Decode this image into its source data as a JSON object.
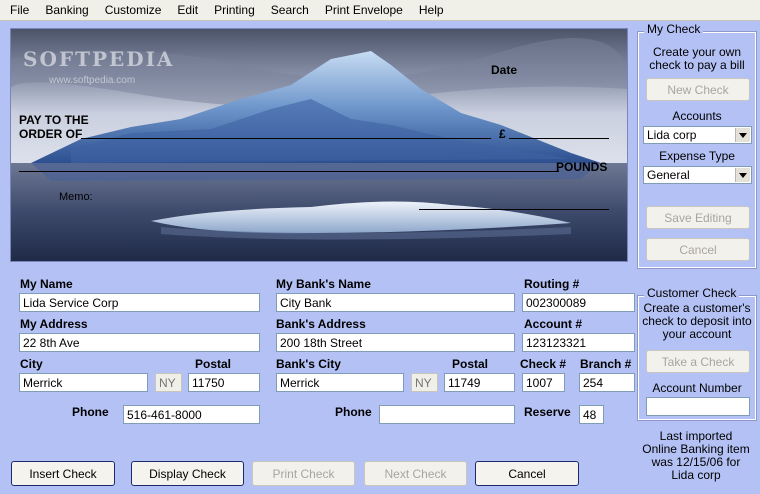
{
  "menu": [
    "File",
    "Banking",
    "Customize",
    "Edit",
    "Printing",
    "Search",
    "Print Envelope",
    "Help"
  ],
  "watermark": {
    "brand": "SOFTPEDIA",
    "url": "www.softpedia.com"
  },
  "check": {
    "date_label": "Date",
    "pay_to_line1": "PAY TO THE",
    "pay_to_line2": "ORDER OF",
    "currency_symbol": "£",
    "pounds_label": "POUNDS",
    "memo_label": "Memo:"
  },
  "my_check": {
    "title": "My Check",
    "description": "Create your own check to pay a bill",
    "new_check_label": "New Check",
    "accounts_label": "Accounts",
    "accounts_value": "Lida corp",
    "expense_label": "Expense Type",
    "expense_value": "General",
    "save_label": "Save Editing",
    "cancel_label": "Cancel"
  },
  "customer_check": {
    "title": "Customer Check",
    "description": "Create a customer's check to deposit into your account",
    "take_check_label": "Take a Check",
    "account_number_label": "Account Number",
    "account_number_value": ""
  },
  "import_note": "Last imported Online Banking item was 12/15/06 for Lida corp",
  "form": {
    "my_name_label": "My Name",
    "my_name": "Lida Service Corp",
    "my_address_label": "My Address",
    "my_address": "22 8th Ave",
    "city_label": "City",
    "city": "Merrick",
    "state_placeholder": "NY",
    "postal_label": "Postal",
    "postal": "11750",
    "phone_label": "Phone",
    "phone": "516-461-8000",
    "bank_name_label": "My Bank's Name",
    "bank_name": "City Bank",
    "bank_address_label": "Bank's Address",
    "bank_address": "200 18th Street",
    "bank_city_label": "Bank's City",
    "bank_city": "Merrick",
    "bank_state_placeholder": "NY",
    "bank_postal_label": "Postal",
    "bank_postal": "11749",
    "bank_phone_label": "Phone",
    "bank_phone": "",
    "routing_label": "Routing #",
    "routing": "002300089",
    "account_label": "Account #",
    "account": "123123321",
    "check_no_label": "Check #",
    "check_no": "1007",
    "branch_label": "Branch #",
    "branch": "254",
    "reserve_label": "Reserve",
    "reserve": "48"
  },
  "bottom": {
    "insert_label": "Insert Check",
    "display_label": "Display Check",
    "print_label": "Print Check",
    "next_label": "Next Check",
    "cancel_label": "Cancel"
  }
}
